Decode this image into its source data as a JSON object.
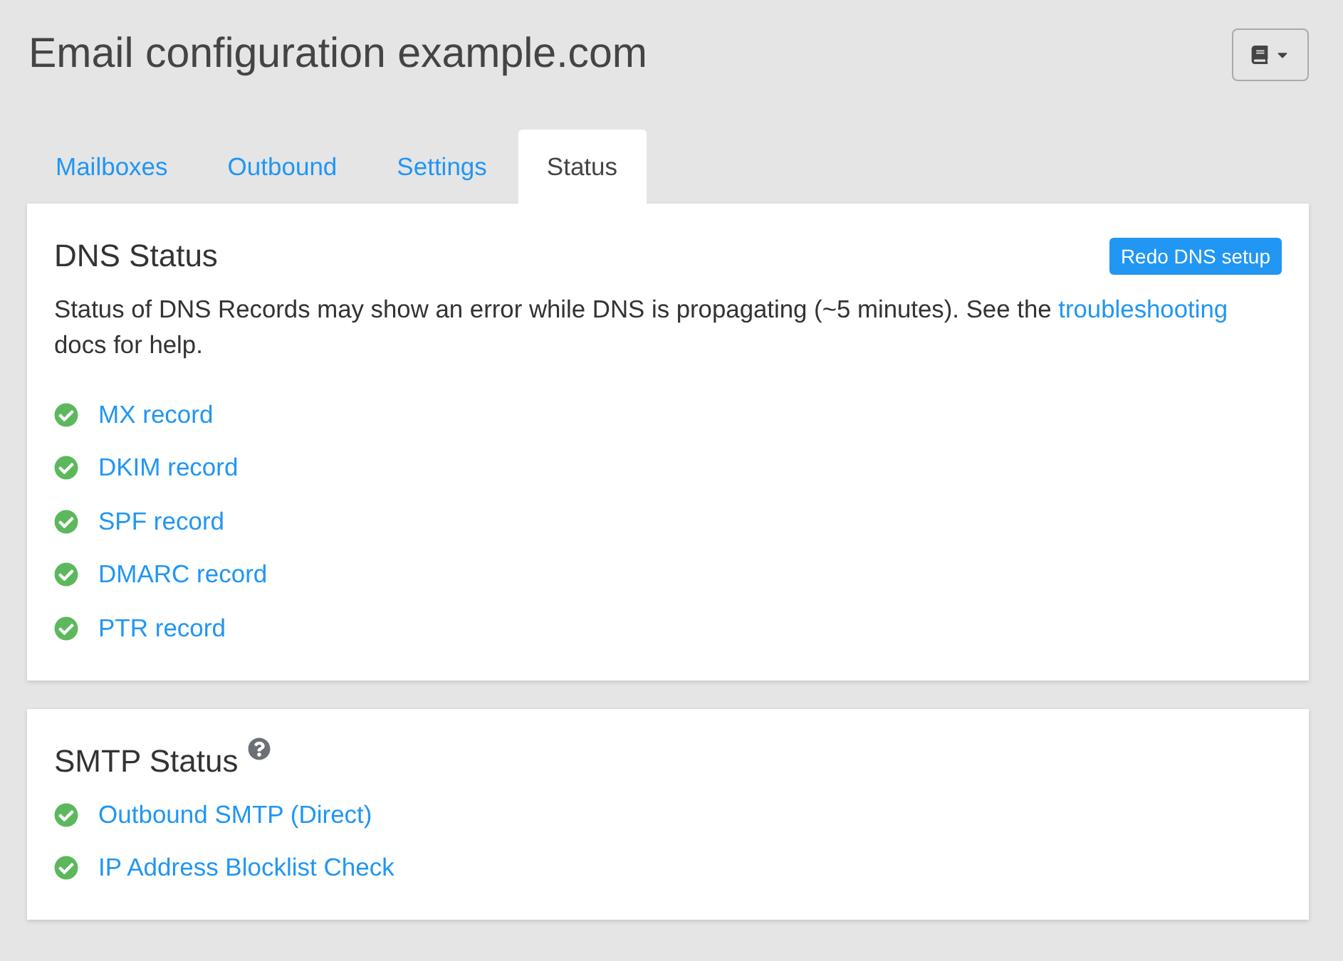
{
  "page": {
    "title": "Email configuration example.com"
  },
  "tabs": [
    {
      "label": "Mailboxes",
      "selected": false
    },
    {
      "label": "Outbound",
      "selected": false
    },
    {
      "label": "Settings",
      "selected": false
    },
    {
      "label": "Status",
      "selected": true
    }
  ],
  "dns_status": {
    "heading": "DNS Status",
    "button": "Redo DNS setup",
    "description": {
      "before": "Status of DNS Records may show an error while DNS is propagating (~5 minutes). See the",
      "link": "troubleshooting",
      "after": "docs for help."
    },
    "records": [
      {
        "label": "MX record",
        "ok": true
      },
      {
        "label": "DKIM record",
        "ok": true
      },
      {
        "label": "SPF record",
        "ok": true
      },
      {
        "label": "DMARC record",
        "ok": true
      },
      {
        "label": "PTR record",
        "ok": true
      }
    ]
  },
  "smtp_status": {
    "heading": "SMTP Status",
    "checks": [
      {
        "label": "Outbound SMTP (Direct)",
        "ok": true
      },
      {
        "label": "IP Address Blocklist Check",
        "ok": true
      }
    ]
  }
}
